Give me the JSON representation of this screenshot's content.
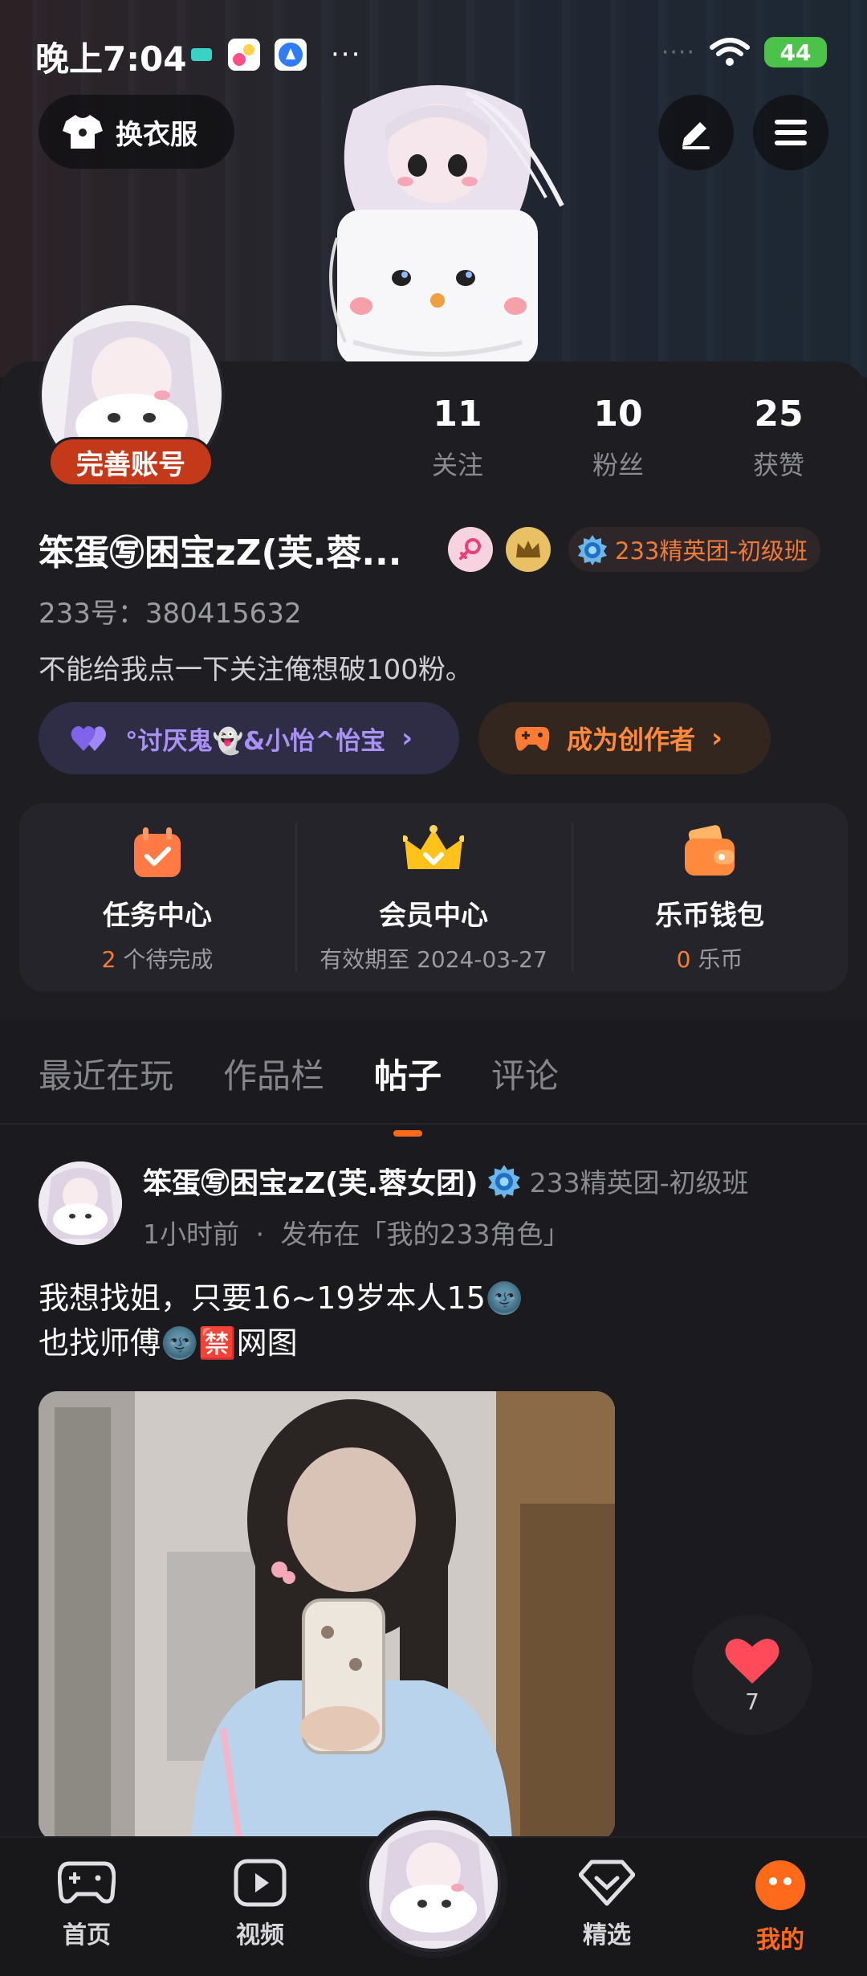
{
  "status_bar": {
    "time": "晚上7:04",
    "dots": "···",
    "signal": "····",
    "battery": "44"
  },
  "header": {
    "outfit_label": "换衣服",
    "edit_icon": "pencil-icon",
    "menu_icon": "hamburger-menu-icon"
  },
  "profile": {
    "complete_label": "完善账号",
    "stats": [
      {
        "value": "11",
        "label": "关注"
      },
      {
        "value": "10",
        "label": "粉丝"
      },
      {
        "value": "25",
        "label": "获赞"
      }
    ],
    "name": "笨蛋㊢困宝zZ(芙.蓉...",
    "rank": "233精英团-初级班",
    "uid": "233号：380415632",
    "bio": "不能给我点一下关注俺想破100粉。",
    "fan_group": "°讨厌鬼👻&小怡^怡宝",
    "creator_label": "成为创作者",
    "chevron": "›"
  },
  "quick_actions": [
    {
      "title": "任务中心",
      "count": "2",
      "suffix": " 个待完成",
      "icon": "task-calendar-icon"
    },
    {
      "title": "会员中心",
      "sub": "有效期至 2024-03-27",
      "icon": "crown-icon"
    },
    {
      "title": "乐币钱包",
      "count": "0",
      "suffix": " 乐币",
      "icon": "wallet-icon"
    }
  ],
  "tabs": [
    {
      "label": "最近在玩"
    },
    {
      "label": "作品栏"
    },
    {
      "label": "帖子",
      "active": true
    },
    {
      "label": "评论"
    }
  ],
  "post": {
    "author": "笨蛋㊢困宝zZ(芙.蓉女团)",
    "rank": "233精英团-初级班",
    "time": "1小时前",
    "separator": "·",
    "published_in": "发布在「我的233角色」",
    "line1": "我想找姐，只要16~19岁本人15🌚",
    "line2": "也找师傅🌚🈲网图",
    "likes": "7"
  },
  "bottom_nav": [
    {
      "label": "首页",
      "icon": "gamepad-icon"
    },
    {
      "label": "视频",
      "icon": "play-icon"
    },
    {
      "label": "精选",
      "icon": "diamond-heart-icon"
    },
    {
      "label": "我的",
      "icon": "smile-face-icon",
      "active": true
    }
  ],
  "colors": {
    "accent": "#ff6a1a",
    "background": "#1b1b1f",
    "card": "#24242a",
    "fan_pill": "#2f2c46",
    "creator_pill": "#33261f"
  }
}
